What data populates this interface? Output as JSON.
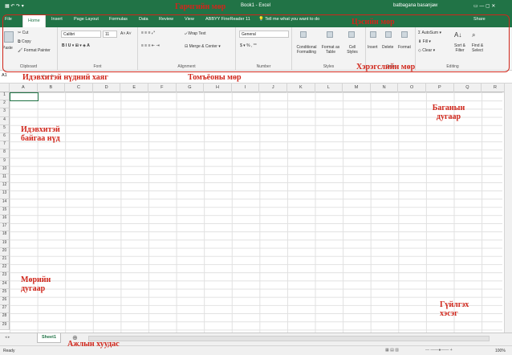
{
  "title": {
    "book": "Book1  -  Excel",
    "user": "batbagana basanjaw"
  },
  "tabs": [
    "File",
    "Home",
    "Insert",
    "Page Layout",
    "Formulas",
    "Data",
    "Review",
    "View",
    "ABBYY FineReader 11",
    "Tell me what you want to do",
    "Share"
  ],
  "clipboard": {
    "paste": "Paste",
    "cut": "Cut",
    "copy": "Copy",
    "format_painter": "Format Painter",
    "label": "Clipboard"
  },
  "font": {
    "name": "Calibri",
    "size": "11",
    "label": "Font"
  },
  "alignment": {
    "wrap": "Wrap Text",
    "merge": "Merge & Center",
    "label": "Alignment"
  },
  "number": {
    "format": "General",
    "label": "Number"
  },
  "styles": {
    "conditional": "Conditional Formatting",
    "format_table": "Format as Table",
    "cell_styles": "Cell Styles",
    "label": "Styles"
  },
  "cells": {
    "insert": "Insert",
    "delete": "Delete",
    "format": "Format",
    "label": "Cells"
  },
  "editing": {
    "autosum": "AutoSum",
    "fill": "Fill",
    "clear": "Clear",
    "sort": "Sort & Filter",
    "find": "Find & Select",
    "label": "Editing"
  },
  "namebox": "A1",
  "columns": [
    "A",
    "B",
    "C",
    "D",
    "E",
    "F",
    "G",
    "H",
    "I",
    "J",
    "K",
    "L",
    "M",
    "N",
    "O",
    "P",
    "Q",
    "R"
  ],
  "rows": [
    "1",
    "2",
    "3",
    "4",
    "5",
    "6",
    "7",
    "8",
    "9",
    "10",
    "11",
    "12",
    "13",
    "14",
    "15",
    "16",
    "17",
    "18",
    "19",
    "20",
    "21",
    "22",
    "23",
    "24",
    "25",
    "26",
    "27",
    "28",
    "29"
  ],
  "sheet": "Sheet1",
  "status": "Ready",
  "zoom": "100%",
  "annotations": {
    "title_bar": "Гарчгийн мөр",
    "menu_bar": "Цэсийн мөр",
    "toolbar": "Хэрэгслийн мөр",
    "active_cell_address": "Идэвхитэй нүдний хаяг",
    "formula_bar": "Томъёоны мөр",
    "column_number": "Баганын дугаар",
    "active_cell": "Идэвхитэй байгаа нүд",
    "row_number": "Мөрийн дугаар",
    "scroll_bar": "Гүйлгэх хэсэг",
    "worksheet": "Ажлын хуудас"
  }
}
